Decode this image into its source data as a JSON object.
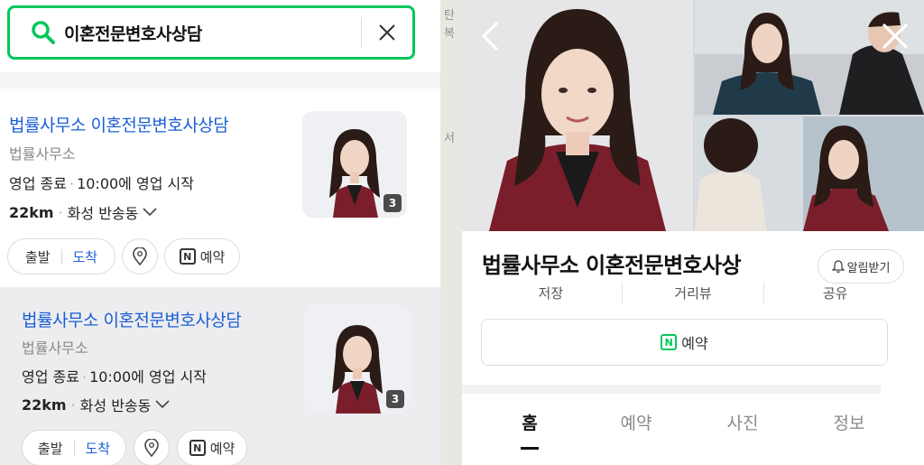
{
  "search": {
    "query": "이혼전문변호사상담"
  },
  "results": [
    {
      "title": "법률사무소 이혼전문변호사상담",
      "category": "법률사무소",
      "status": "영업 종료",
      "hours_note": "10:00에 영업 시작",
      "distance": "22km",
      "address": "화성 반송동",
      "photo_count": "3",
      "start_label": "출발",
      "arrive_label": "도착",
      "reserve_label": "예약"
    },
    {
      "title": "법률사무소 이혼전문변호사상담",
      "category": "법률사무소",
      "status": "영업 종료",
      "hours_note": "10:00에 영업 시작",
      "distance": "22km",
      "address": "화성 반송동",
      "photo_count": "3",
      "start_label": "출발",
      "arrive_label": "도착",
      "reserve_label": "예약"
    }
  ],
  "map": {
    "labels": [
      "탄",
      "복",
      "서"
    ]
  },
  "detail": {
    "name": "법률사무소 이혼전문변호사상",
    "alarm_label": "알림받기",
    "actions": [
      "저장",
      "거리뷰",
      "공유"
    ],
    "reserve_label": "예약",
    "tabs": [
      "홈",
      "예약",
      "사진",
      "정보"
    ],
    "active_tab": "홈"
  },
  "colors": {
    "brand_green": "#03c75a",
    "link_blue": "#1a5fd6",
    "jacket": "#7a1e2b"
  },
  "icons": {
    "search": "search-icon",
    "clear": "close-icon",
    "location": "location-pin-icon",
    "naver_booking": "naver-n-icon",
    "back": "chevron-left-icon",
    "close": "close-icon",
    "bell": "bell-icon",
    "dropdown": "chevron-down-icon"
  }
}
